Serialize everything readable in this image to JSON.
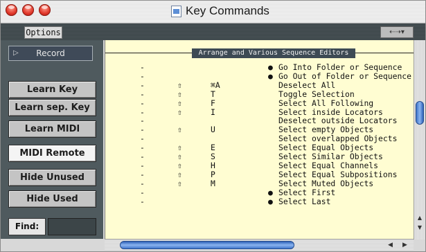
{
  "window": {
    "title": "Key Commands"
  },
  "toolbar": {
    "options_label": "Options",
    "right_control_label": "⇠⇢▾"
  },
  "sidebar": {
    "record_label": "Record",
    "buttons": {
      "learn_key": "Learn Key",
      "learn_sep_key": "Learn sep. Key",
      "learn_midi": "Learn MIDI",
      "midi_remote": "MIDI Remote",
      "hide_unused": "Hide Unused",
      "hide_used": "Hide Used"
    },
    "find_label": "Find:",
    "find_value": ""
  },
  "list": {
    "section_header": "Arrange and Various Sequence Editors",
    "rows": [
      {
        "dash": "-",
        "shift": "",
        "key": "",
        "bullet": "●",
        "name": "Go Into Folder or Sequence"
      },
      {
        "dash": "-",
        "shift": "",
        "key": "",
        "bullet": "●",
        "name": "Go Out of Folder or Sequence"
      },
      {
        "dash": "-",
        "shift": "⇧",
        "key": "⌘A",
        "bullet": "",
        "name": "Deselect All"
      },
      {
        "dash": "-",
        "shift": "⇧",
        "key": "T",
        "bullet": "",
        "name": "Toggle Selection"
      },
      {
        "dash": "-",
        "shift": "⇧",
        "key": "F",
        "bullet": "",
        "name": "Select All Following"
      },
      {
        "dash": "-",
        "shift": "⇧",
        "key": "I",
        "bullet": "",
        "name": "Select inside Locators"
      },
      {
        "dash": "-",
        "shift": "",
        "key": "",
        "bullet": "",
        "name": "Deselect outside Locators"
      },
      {
        "dash": "-",
        "shift": "⇧",
        "key": "U",
        "bullet": "",
        "name": "Select empty Objects"
      },
      {
        "dash": "-",
        "shift": "",
        "key": "",
        "bullet": "",
        "name": "Select overlapped Objects"
      },
      {
        "dash": "-",
        "shift": "⇧",
        "key": "E",
        "bullet": "",
        "name": "Select Equal Objects"
      },
      {
        "dash": "-",
        "shift": "⇧",
        "key": "S",
        "bullet": "",
        "name": "Select Similar Objects"
      },
      {
        "dash": "-",
        "shift": "⇧",
        "key": "H",
        "bullet": "",
        "name": "Select Equal Channels"
      },
      {
        "dash": "-",
        "shift": "⇧",
        "key": "P",
        "bullet": "",
        "name": "Select Equal Subpositions"
      },
      {
        "dash": "-",
        "shift": "⇧",
        "key": "M",
        "bullet": "",
        "name": "Select Muted Objects"
      },
      {
        "dash": "-",
        "shift": "",
        "key": "",
        "bullet": "●",
        "name": "Select First"
      },
      {
        "dash": "-",
        "shift": "",
        "key": "",
        "bullet": "●",
        "name": "Select Last"
      }
    ]
  },
  "colors": {
    "list_background": "#fffdd2",
    "panel_background": "#4f5a5e",
    "scroll_thumb": "#4a7fd4",
    "section_header_bg": "#3d4a54"
  }
}
